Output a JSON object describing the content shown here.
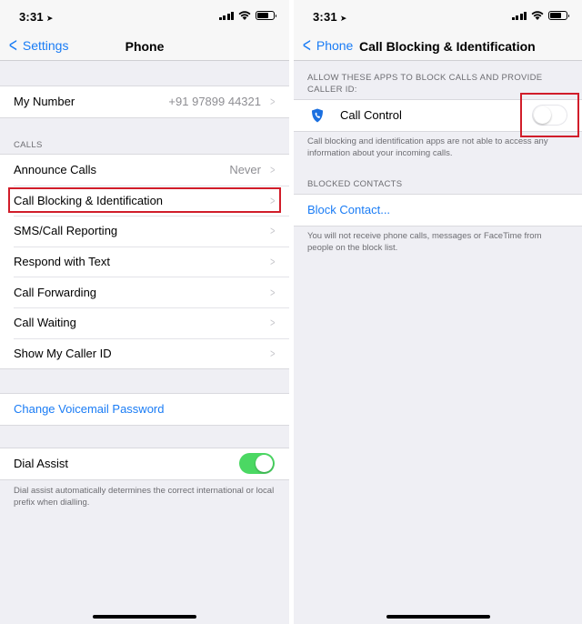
{
  "left": {
    "status": {
      "time": "3:31"
    },
    "nav": {
      "back_label": "Settings",
      "title": "Phone"
    },
    "my_number": {
      "label": "My Number",
      "value": "+91 97899 44321"
    },
    "calls_header": "CALLS",
    "calls_items": [
      {
        "label": "Announce Calls",
        "value": "Never"
      },
      {
        "label": "Call Blocking & Identification"
      },
      {
        "label": "SMS/Call Reporting"
      },
      {
        "label": "Respond with Text"
      },
      {
        "label": "Call Forwarding"
      },
      {
        "label": "Call Waiting"
      },
      {
        "label": "Show My Caller ID"
      }
    ],
    "voicemail_link": "Change Voicemail Password",
    "dial_assist": {
      "label": "Dial Assist",
      "enabled": true
    },
    "dial_assist_note": "Dial assist automatically determines the correct international or local prefix when dialling."
  },
  "right": {
    "status": {
      "time": "3:31"
    },
    "nav": {
      "back_label": "Phone",
      "title": "Call Blocking & Identification"
    },
    "allow_header": "ALLOW THESE APPS TO BLOCK CALLS AND PROVIDE CALLER ID:",
    "app": {
      "label": "Call Control",
      "enabled": false
    },
    "allow_note": "Call blocking and identification apps are not able to access any information about your incoming calls.",
    "blocked_header": "BLOCKED CONTACTS",
    "block_contact": "Block Contact...",
    "blocked_note": "You will not receive phone calls, messages or FaceTime from people on the block list."
  },
  "colors": {
    "accent": "#1a7cf5",
    "toggle_on": "#4bd863",
    "highlight": "#d11d2a",
    "background": "#efeff4"
  },
  "icons": [
    "location-arrow-icon",
    "signal-icon",
    "wifi-icon",
    "battery-icon",
    "chevron-left-icon",
    "chevron-right-icon",
    "shield-phone-icon"
  ]
}
